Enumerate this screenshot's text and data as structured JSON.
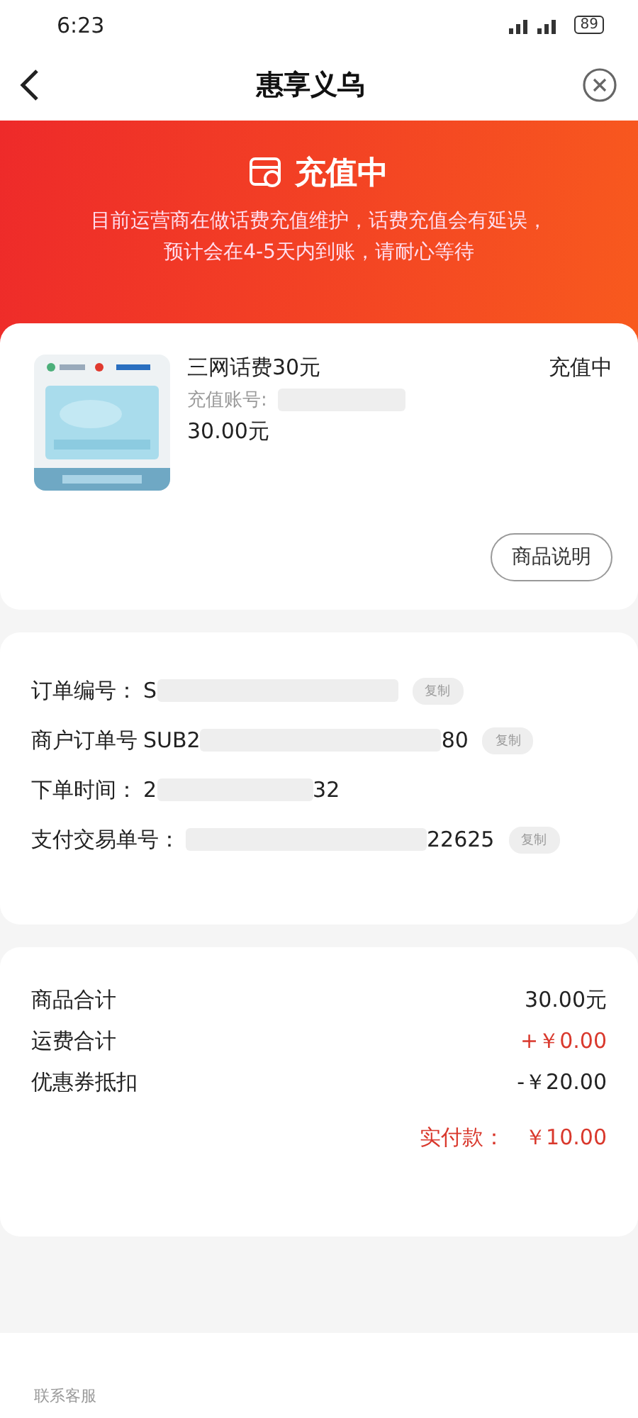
{
  "status_bar": {
    "time": "6:23",
    "battery": "89"
  },
  "nav": {
    "title": "惠享义乌"
  },
  "banner": {
    "title": "充值中",
    "message": "目前运营商在做话费充值维护，话费充值会有延误，预计会在4-5天内到账，请耐心等待"
  },
  "product": {
    "name": "三网话费30元",
    "status": "充值中",
    "account_label": "充值账号:",
    "price": "30.00元",
    "button": "商品说明"
  },
  "order_info": [
    {
      "label": "订单编号：",
      "value_start": "S",
      "copy": "复制"
    },
    {
      "label": "商户订单号",
      "value_start": "SUB2",
      "value_end": "80",
      "copy": "复制"
    },
    {
      "label": "下单时间：",
      "value_start": "2",
      "value_end": "32"
    },
    {
      "label": "支付交易单号：",
      "value_end": "22625",
      "copy": "复制"
    }
  ],
  "summary": [
    {
      "label": "商品合计",
      "value": "30.00元",
      "highlight": false
    },
    {
      "label": "运费合计",
      "value": "+￥0.00",
      "highlight": true
    },
    {
      "label": "优惠券抵扣",
      "value": "-￥20.00",
      "highlight": false
    }
  ],
  "total": {
    "label": "实付款：",
    "value": "￥10.00"
  },
  "bottom_bar": {
    "contact": "联系客服"
  }
}
